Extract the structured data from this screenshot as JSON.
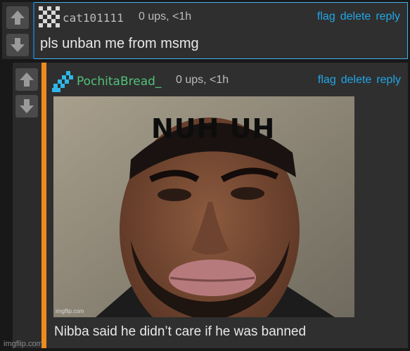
{
  "comments": [
    {
      "username": "cat101111",
      "meta": "0 ups, <1h",
      "actions": {
        "flag": "flag",
        "delete": "delete",
        "reply": "reply"
      },
      "text": "pls unban me from msmg",
      "avatar_icon": "checker-avatar-icon"
    },
    {
      "username": "PochitaBread_",
      "meta": "0 ups, <1h",
      "actions": {
        "flag": "flag",
        "delete": "delete",
        "reply": "reply"
      },
      "text": "Nibba said he didn’t care if he was banned",
      "avatar_icon": "pixel-avatar-icon",
      "image": {
        "caption": "NUH UH",
        "watermark": "imgflip.com"
      }
    }
  ],
  "footer": {
    "watermark": "imgflip.com"
  },
  "colors": {
    "link": "#22a7e8",
    "reply_bar": "#f08a1c",
    "selected_border": "#3fb3f0",
    "username_green": "#52c07a"
  }
}
